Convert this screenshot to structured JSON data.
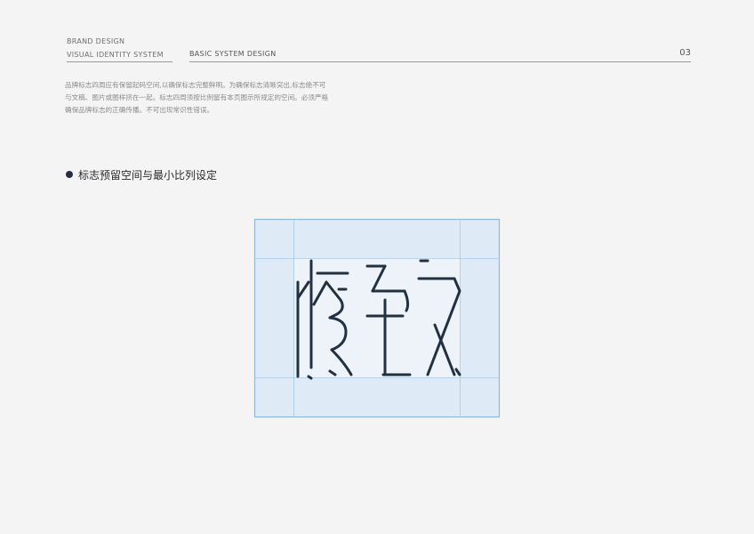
{
  "header": {
    "brand_design": "BRAND DESIGN",
    "visual_identity": "VISUAL IDENTITY SYSTEM",
    "section": "BASIC SYSTEM DESIGN",
    "page_number": "03"
  },
  "description": {
    "line1": "品牌标志四周应有保留起码空间,以确保标志完整鲜明。为确保标志清晰突出,标志绝不可",
    "line2": "与文稿、图片或图样挤在一起。标志四周须按比例留有本页图示所规定的空间。必须严格",
    "line3": "确保品牌标志的正确传播。不可出现常识性错误。"
  },
  "section_title": "标志预留空间与最小比列设定",
  "colors": {
    "logo_stroke": "#223142",
    "guide_line": "#8fb8e0",
    "margin_fill": "#dde9f5",
    "inner_fill": "#edf3f9"
  }
}
